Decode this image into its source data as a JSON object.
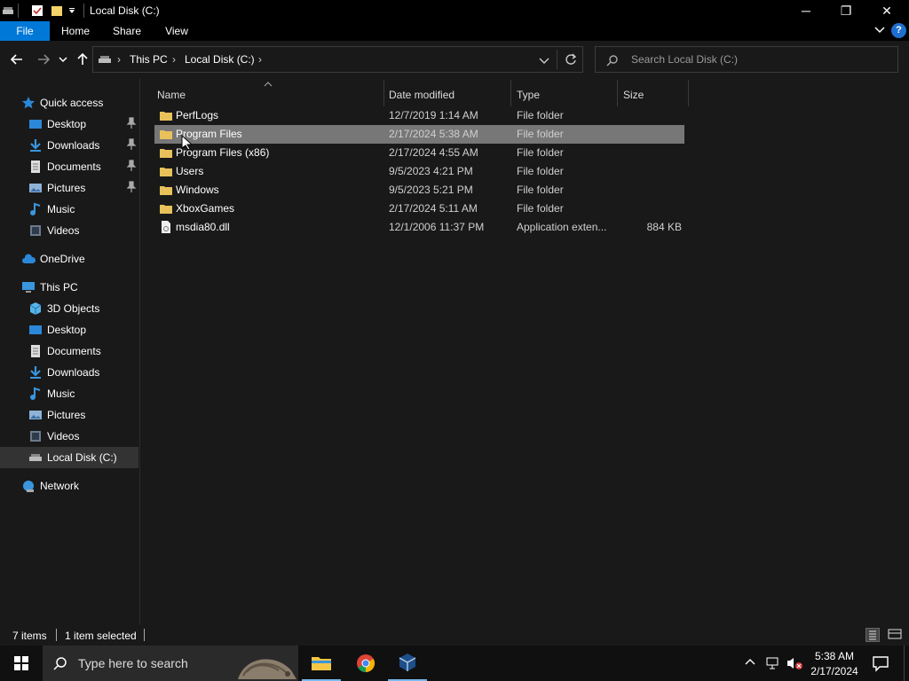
{
  "window": {
    "title": "Local Disk (C:)",
    "minimize_glyph": "─",
    "restore_glyph": "❐",
    "close_glyph": "✕"
  },
  "ribbon": {
    "tabs": [
      {
        "label": "File",
        "active": true
      },
      {
        "label": "Home"
      },
      {
        "label": "Share"
      },
      {
        "label": "View"
      }
    ],
    "help_glyph": "?"
  },
  "address": {
    "crumbs": [
      "This PC",
      "Local Disk (C:)"
    ],
    "separator": "›"
  },
  "search": {
    "placeholder": "Search Local Disk (C:)"
  },
  "sidebar": {
    "items": [
      {
        "label": "Quick access",
        "icon": "star-icon"
      },
      {
        "label": "Desktop",
        "icon": "desktop-icon",
        "pinned": true
      },
      {
        "label": "Downloads",
        "icon": "download-icon",
        "pinned": true
      },
      {
        "label": "Documents",
        "icon": "document-icon",
        "pinned": true
      },
      {
        "label": "Pictures",
        "icon": "pictures-icon",
        "pinned": true
      },
      {
        "label": "Music",
        "icon": "music-icon"
      },
      {
        "label": "Videos",
        "icon": "videos-icon"
      },
      {
        "label": "OneDrive",
        "icon": "cloud-icon"
      },
      {
        "label": "This PC",
        "icon": "computer-icon"
      },
      {
        "label": "3D Objects",
        "icon": "cube-icon"
      },
      {
        "label": "Desktop",
        "icon": "desktop-icon"
      },
      {
        "label": "Documents",
        "icon": "document-icon"
      },
      {
        "label": "Downloads",
        "icon": "download-icon"
      },
      {
        "label": "Music",
        "icon": "music-icon"
      },
      {
        "label": "Pictures",
        "icon": "pictures-icon"
      },
      {
        "label": "Videos",
        "icon": "videos-icon"
      },
      {
        "label": "Local Disk (C:)",
        "icon": "drive-icon",
        "selected": true
      },
      {
        "label": "Network",
        "icon": "network-icon"
      }
    ]
  },
  "columns": [
    "Name",
    "Date modified",
    "Type",
    "Size"
  ],
  "files": [
    {
      "name": "PerfLogs",
      "date": "12/7/2019 1:14 AM",
      "type": "File folder",
      "size": "",
      "kind": "folder"
    },
    {
      "name": "Program Files",
      "date": "2/17/2024 5:38 AM",
      "type": "File folder",
      "size": "",
      "kind": "folder",
      "selected": true
    },
    {
      "name": "Program Files (x86)",
      "date": "2/17/2024 4:55 AM",
      "type": "File folder",
      "size": "",
      "kind": "folder"
    },
    {
      "name": "Users",
      "date": "9/5/2023 4:21 PM",
      "type": "File folder",
      "size": "",
      "kind": "folder"
    },
    {
      "name": "Windows",
      "date": "9/5/2023 5:21 PM",
      "type": "File folder",
      "size": "",
      "kind": "folder"
    },
    {
      "name": "XboxGames",
      "date": "2/17/2024 5:11 AM",
      "type": "File folder",
      "size": "",
      "kind": "folder"
    },
    {
      "name": "msdia80.dll",
      "date": "12/1/2006 11:37 PM",
      "type": "Application exten...",
      "size": "884 KB",
      "kind": "file"
    }
  ],
  "status": {
    "items_count": "7 items",
    "selection": "1 item selected"
  },
  "taskbar": {
    "search_placeholder": "Type here to search",
    "time": "5:38 AM",
    "date": "2/17/2024"
  },
  "colors": {
    "background": "#191919",
    "selection": "#777777",
    "accent": "#0078d7",
    "folder": "#e8c15a"
  }
}
